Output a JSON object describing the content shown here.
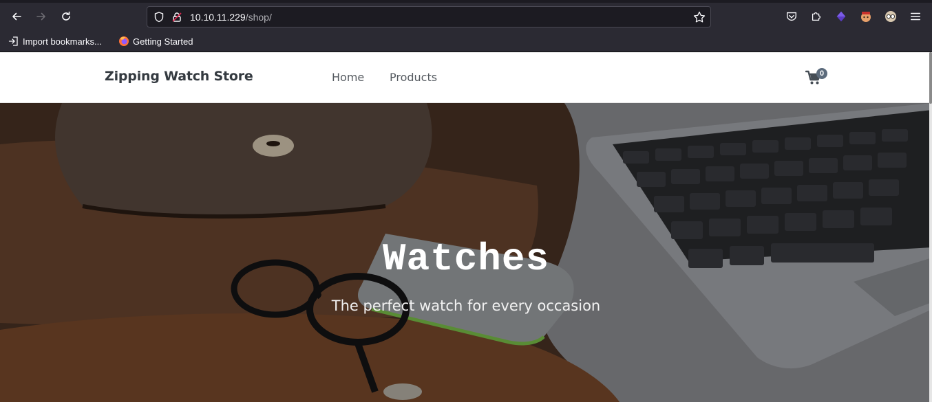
{
  "browser": {
    "url_host": "10.10.11.229",
    "url_path": "/shop/",
    "bookmarks": [
      {
        "label": "Import bookmarks...",
        "icon": "import-icon"
      },
      {
        "label": "Getting Started",
        "icon": "firefox-icon"
      }
    ]
  },
  "site": {
    "brand": "Zipping Watch Store",
    "nav": [
      {
        "label": "Home"
      },
      {
        "label": "Products"
      }
    ],
    "cart_count": "0"
  },
  "hero": {
    "title": "Watches",
    "subtitle": "The perfect watch for every occasion"
  },
  "colors": {
    "chrome_bg": "#2b2a33",
    "urlbar_bg": "#1c1b22",
    "brand_text": "#343a40",
    "badge": "#5c6b7c"
  }
}
